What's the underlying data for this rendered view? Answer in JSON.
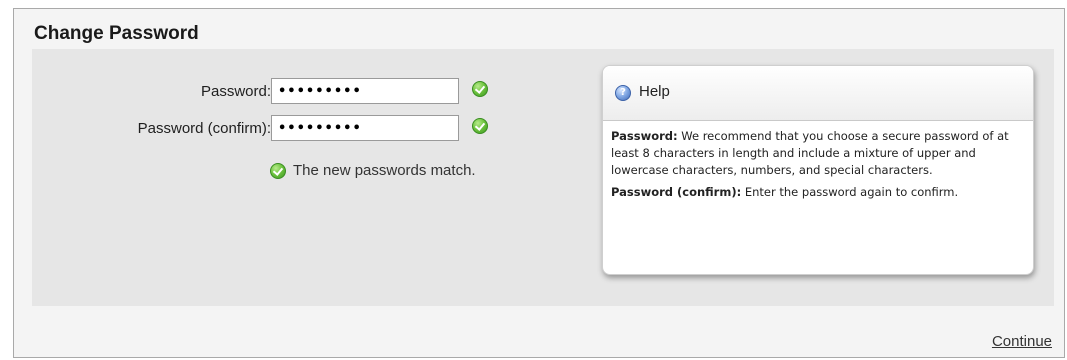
{
  "title": "Change Password",
  "fields": [
    {
      "label": "Password:",
      "value": "•••••••••"
    },
    {
      "label": "Password (confirm):",
      "value": "•••••••••"
    }
  ],
  "match_message": "The new passwords match.",
  "help": {
    "title": "Help",
    "items": [
      {
        "term": "Password:",
        "text": " We recommend that you choose a secure password of at least 8 characters in length and include a mixture of upper and lowercase characters, numbers, and special characters."
      },
      {
        "term": "Password (confirm):",
        "text": " Enter the password again to confirm."
      }
    ]
  },
  "continue_label": "Continue",
  "icons": {
    "valid": "check-circle-icon",
    "help": "info-icon"
  }
}
